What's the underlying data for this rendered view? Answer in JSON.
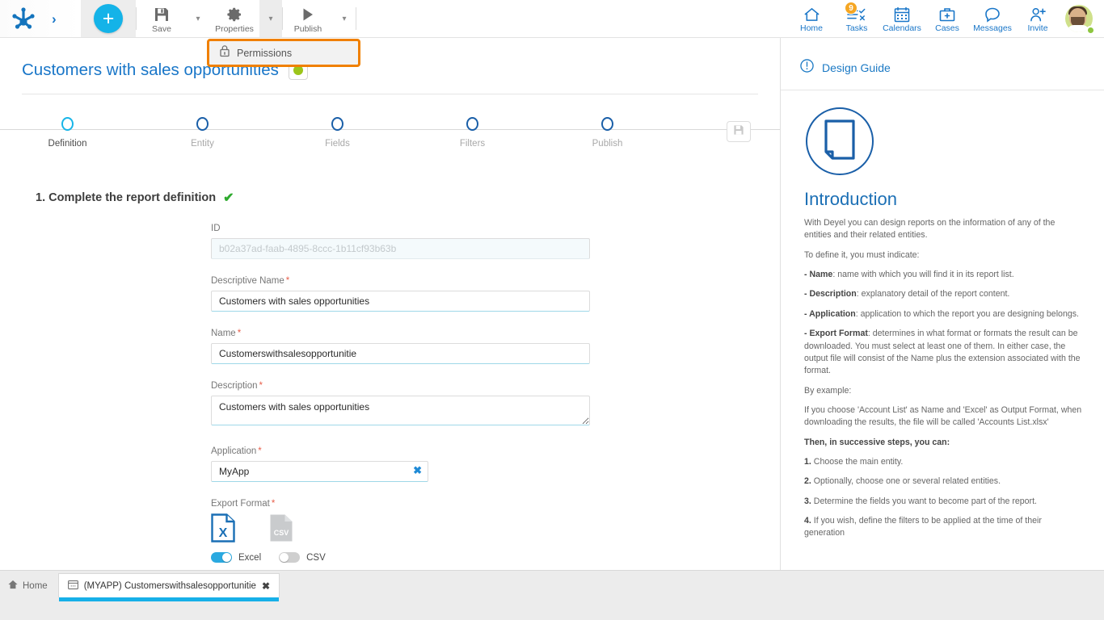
{
  "topbar": {
    "logo_name": "deyel-logo",
    "expand_label": "›",
    "add_label": "+",
    "tools": [
      {
        "id": "save",
        "label": "Save",
        "icon": "floppy-disk-icon",
        "caret": true,
        "caret_active": false
      },
      {
        "id": "properties",
        "label": "Properties",
        "icon": "gear-icon",
        "caret": true,
        "caret_active": true
      },
      {
        "id": "publish",
        "label": "Publish",
        "icon": "play-icon",
        "caret": true,
        "caret_active": false
      }
    ],
    "right_items": [
      {
        "id": "home",
        "label": "Home",
        "icon": "home-icon",
        "badge": ""
      },
      {
        "id": "tasks",
        "label": "Tasks",
        "icon": "tasks-icon",
        "badge": "9"
      },
      {
        "id": "calendars",
        "label": "Calendars",
        "icon": "calendar-icon",
        "badge": ""
      },
      {
        "id": "cases",
        "label": "Cases",
        "icon": "briefcase-icon",
        "badge": ""
      },
      {
        "id": "messages",
        "label": "Messages",
        "icon": "chat-icon",
        "badge": ""
      },
      {
        "id": "invite",
        "label": "Invite",
        "icon": "user-plus-icon",
        "badge": ""
      }
    ],
    "avatar_name": "user-avatar",
    "avatar_status": "online"
  },
  "permissions_menu": {
    "label": "Permissions",
    "icon": "lock-icon",
    "highlight_color": "#f08000"
  },
  "page": {
    "title": "Customers with sales opportunities",
    "status_color": "#9cc51a"
  },
  "stepper": {
    "steps": [
      {
        "label": "Definition",
        "active": true
      },
      {
        "label": "Entity",
        "active": false
      },
      {
        "label": "Fields",
        "active": false
      },
      {
        "label": "Filters",
        "active": false
      },
      {
        "label": "Publish",
        "active": false
      }
    ],
    "save_icon": "floppy-disk-icon"
  },
  "section": {
    "heading": "1. Complete the report definition",
    "check": "✔"
  },
  "form": {
    "id": {
      "label": "ID",
      "value": "b02a37ad-faab-4895-8ccc-1b11cf93b63b",
      "required": false
    },
    "descriptive_name": {
      "label": "Descriptive Name",
      "value": "Customers with sales opportunities",
      "required": true
    },
    "name": {
      "label": "Name",
      "value": "Customerswithsalesopportunitie",
      "required": true
    },
    "description": {
      "label": "Description",
      "value": "Customers with sales opportunities",
      "required": true
    },
    "application": {
      "label": "Application",
      "value": "MyApp",
      "required": true,
      "clear_icon": "close-icon"
    },
    "export_format": {
      "label": "Export Format",
      "required": true,
      "options": [
        {
          "id": "excel",
          "label": "Excel",
          "icon": "excel-file-icon",
          "enabled": true
        },
        {
          "id": "csv",
          "label": "CSV",
          "icon": "csv-file-icon",
          "enabled": false
        }
      ]
    },
    "required_marker": "*"
  },
  "right_panel": {
    "header": "Design Guide",
    "header_icon": "info-icon",
    "guide_icon": "document-icon",
    "title": "Introduction",
    "paragraphs": [
      {
        "text": "With Deyel you can design reports on the information of any of the entities and their related entities."
      },
      {
        "text": "To define it, you must indicate:"
      },
      {
        "strong": "- Name",
        "text": ": name with which you will find it in its report list."
      },
      {
        "strong": "- Description",
        "text": ": explanatory detail of the report content."
      },
      {
        "strong": "- Application",
        "text": ": application to which the report you are designing belongs."
      },
      {
        "strong": "- Export Format",
        "text": ": determines in what format or formats the result can be downloaded. You must select at least one of them. In either case, the output file will consist of the Name plus the extension associated with the format."
      },
      {
        "text": "By example:"
      },
      {
        "text": "If you choose 'Account List' as Name and 'Excel' as Output Format, when downloading the results, the file will be called 'Accounts List.xlsx'"
      },
      {
        "strong": "Then, in successive steps, you can:",
        "text": ""
      },
      {
        "strong": "1.",
        "text": " Choose the main entity."
      },
      {
        "strong": "2.",
        "text": " Optionally, choose one or several related entities."
      },
      {
        "strong": "3.",
        "text": " Determine the fields you want to become part of the report."
      },
      {
        "strong": "4.",
        "text": " If you wish, define the filters to be applied at the time of their generation"
      }
    ]
  },
  "taskbar": {
    "home_label": "Home",
    "home_icon": "home-icon",
    "tab": {
      "label": "(MYAPP) Customerswithsalesopportunitie",
      "icon": "window-icon",
      "close_icon": "close-icon"
    }
  }
}
